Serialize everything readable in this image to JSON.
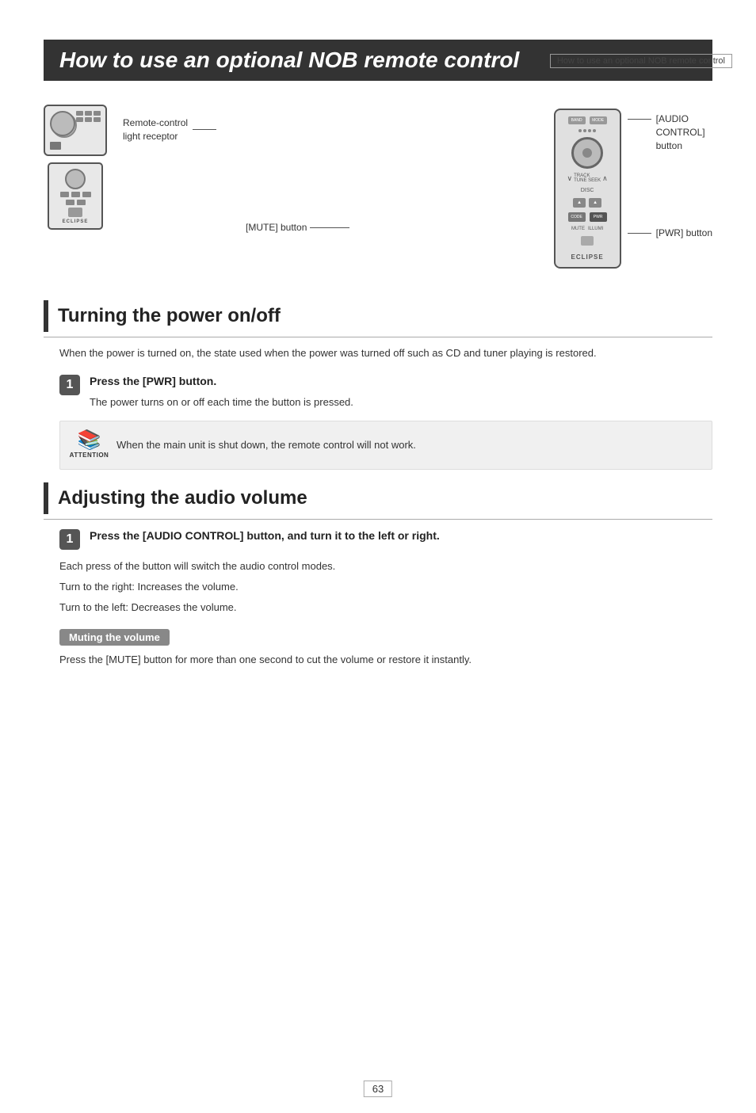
{
  "header": {
    "page_ref": "How to use an optional NOB remote control"
  },
  "title": "How to use an optional NOB remote control",
  "diagram": {
    "left_label": "Remote-control\nlight receptor",
    "mute_label": "[MUTE] button",
    "pwr_label": "[PWR] button",
    "audio_control_label": "[AUDIO\nCONTROL]\nbutton"
  },
  "section1": {
    "title": "Turning the power on/off",
    "intro": "When the power is turned on, the state used when the power was turned off such as CD and tuner playing is restored.",
    "step1_badge": "1",
    "step1_title": "Press the [PWR] button.",
    "step1_desc": "The power turns on or off each time the button is pressed.",
    "attention_text": "When the main unit is shut down, the remote control will not work.",
    "attention_label": "ATTENTION"
  },
  "section2": {
    "title": "Adjusting the audio volume",
    "step1_badge": "1",
    "step1_title": "Press the [AUDIO CONTROL] button, and turn it to the left or right.",
    "audio_info1": "Each press of the button will switch the audio control modes.",
    "audio_info2": "Turn to the right:  Increases the volume.",
    "audio_info3": "Turn to the left:    Decreases the volume.",
    "sub_tag": "Muting the volume",
    "mute_desc": "Press the [MUTE] button for more than one second to cut the volume or restore it instantly."
  },
  "page_number": "63"
}
